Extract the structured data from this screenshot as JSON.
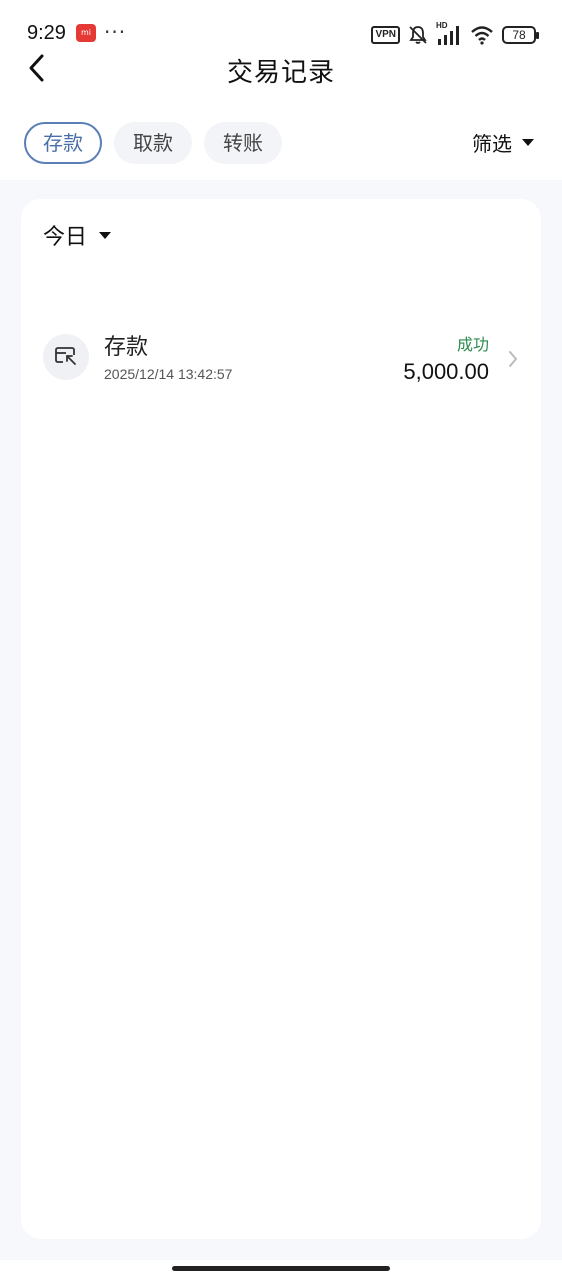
{
  "status_bar": {
    "time": "9:29",
    "app_icon_label": "mi",
    "dots": "···",
    "vpn": "VPN",
    "hd": "HD",
    "battery": "78"
  },
  "header": {
    "title": "交易记录"
  },
  "tabs": [
    {
      "label": "存款",
      "active": true
    },
    {
      "label": "取款",
      "active": false
    },
    {
      "label": "转账",
      "active": false
    }
  ],
  "filter": {
    "label": "筛选"
  },
  "date_filter": {
    "label": "今日"
  },
  "transactions": [
    {
      "type": "存款",
      "time": "2025/12/14 13:42:57",
      "status": "成功",
      "amount": "5,000.00",
      "icon": "deposit-icon"
    }
  ],
  "colors": {
    "accent": "#5a7fb8",
    "success": "#2e8b4e",
    "background": "#f6f8fc"
  }
}
